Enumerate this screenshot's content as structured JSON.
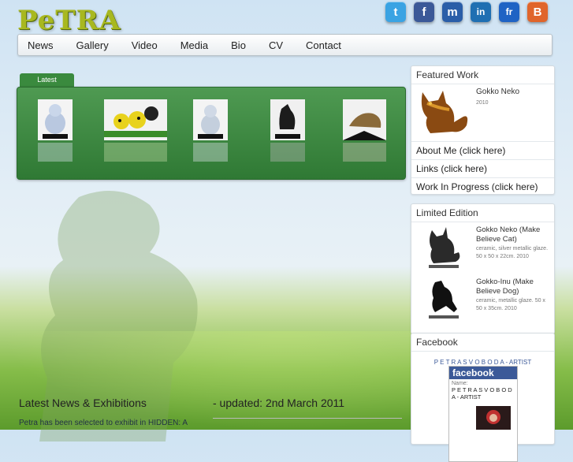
{
  "site": {
    "logo_text": "PeTRA"
  },
  "social": [
    {
      "name": "twitter-icon",
      "glyph": "t",
      "color": "#3aa3e3"
    },
    {
      "name": "facebook-icon",
      "glyph": "f",
      "color": "#3b5998"
    },
    {
      "name": "myspace-icon",
      "glyph": "m",
      "color": "#2a5ea8"
    },
    {
      "name": "linkedin-icon",
      "glyph": "in",
      "color": "#1f6fb2"
    },
    {
      "name": "flickr-icon",
      "glyph": "fr",
      "color": "#1f63c4"
    },
    {
      "name": "blogger-icon",
      "glyph": "B",
      "color": "#e0652b"
    }
  ],
  "nav": [
    "News",
    "Gallery",
    "Video",
    "Media",
    "Bio",
    "CV",
    "Contact"
  ],
  "gallery": {
    "tab_label": "Latest"
  },
  "featured": {
    "title": "Featured Work",
    "item_title": "Gokko Neko",
    "item_year": "2010",
    "links": [
      "About Me (click here)",
      "Links (click here)",
      "Work In Progress (click here)"
    ]
  },
  "limited": {
    "title": "Limited Edition",
    "items": [
      {
        "title": "Gokko Neko (Make Believe Cat)",
        "meta": "ceramic, silver metallic glaze. 50 x 50 x 22cm. 2010"
      },
      {
        "title": "Gokko-Inu (Make Believe Dog)",
        "meta": "ceramic, metallic glaze. 50 x 50 x 35cm. 2010"
      }
    ]
  },
  "facebook": {
    "title": "Facebook",
    "page_name": "P E T R A S V O B O D A - ARTIST",
    "widget_brand": "facebook",
    "widget_name_label": "Name:",
    "widget_name": "P E T R A S V O B O D A - ARTIST"
  },
  "news": {
    "heading": "Latest News & Exhibitions",
    "updated": "- updated: 2nd March 2011",
    "body": "Petra has been selected to exhibit in HIDDEN: A"
  }
}
